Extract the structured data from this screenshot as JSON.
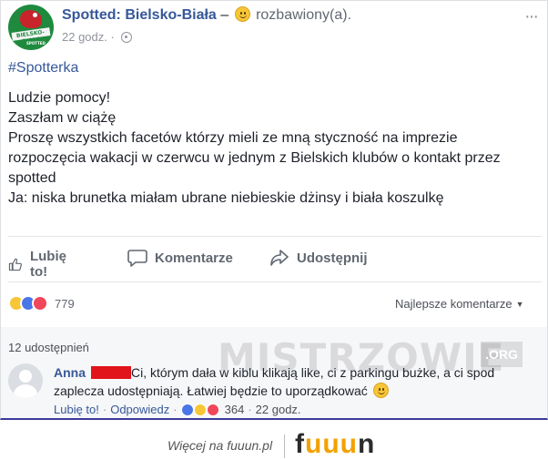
{
  "post": {
    "page_name": "Spotted: Bielsko-Biała",
    "dash": "–",
    "feeling": "rozbawiony(a).",
    "time": "22 godz.",
    "dot": "·",
    "avatar_text": "BIELSKO-BIAŁA",
    "avatar_sub": "SPOTTED",
    "more_label": "···",
    "hashtag": "#Spotterka",
    "lines": [
      "Ludzie pomocy!",
      "Zaszłam w ciążę",
      "Proszę wszystkich facetów którzy mieli ze mną styczność na imprezie",
      "rozpoczęcia wakacji w czerwcu w jednym z Bielskich klubów o kontakt przez",
      "spotted",
      "Ja: niska brunetka miałam ubrane niebieskie dżinsy i biała koszulkę"
    ]
  },
  "actions": {
    "like": "Lubię to!",
    "comment": "Komentarze",
    "share": "Udostępnij"
  },
  "reactions": {
    "count": "779",
    "sort_label": "Najlepsze komentarze",
    "shares": "12 udostępnień"
  },
  "comment": {
    "author": "Anna",
    "text_1": "Ci, którym dała w kiblu klikają like, ci z parkingu bużke, a ci spod",
    "text_2": "zaplecza udostępniają. Łatwiej będzie to uporządkować",
    "like": "Lubię to!",
    "sep": "·",
    "reply": "Odpowiedz",
    "count": "364",
    "time": "22 godz."
  },
  "watermark": {
    "text": "MISTRZOWIE",
    "org": ".ORG"
  },
  "footer": {
    "text": "Więcej na fuuun.pl",
    "brand_f": "f",
    "brand_uuu": "uuu",
    "brand_n": "n"
  },
  "colors": {
    "link": "#365899",
    "redaction": "#e1141b",
    "brand_accent": "#f2a200"
  },
  "icons": [
    "more-icon",
    "globe-icon",
    "like-icon",
    "comment-icon",
    "share-icon",
    "haha-reaction-icon",
    "like-reaction-icon",
    "love-reaction-icon",
    "caret-down-icon",
    "smiley-icon"
  ]
}
